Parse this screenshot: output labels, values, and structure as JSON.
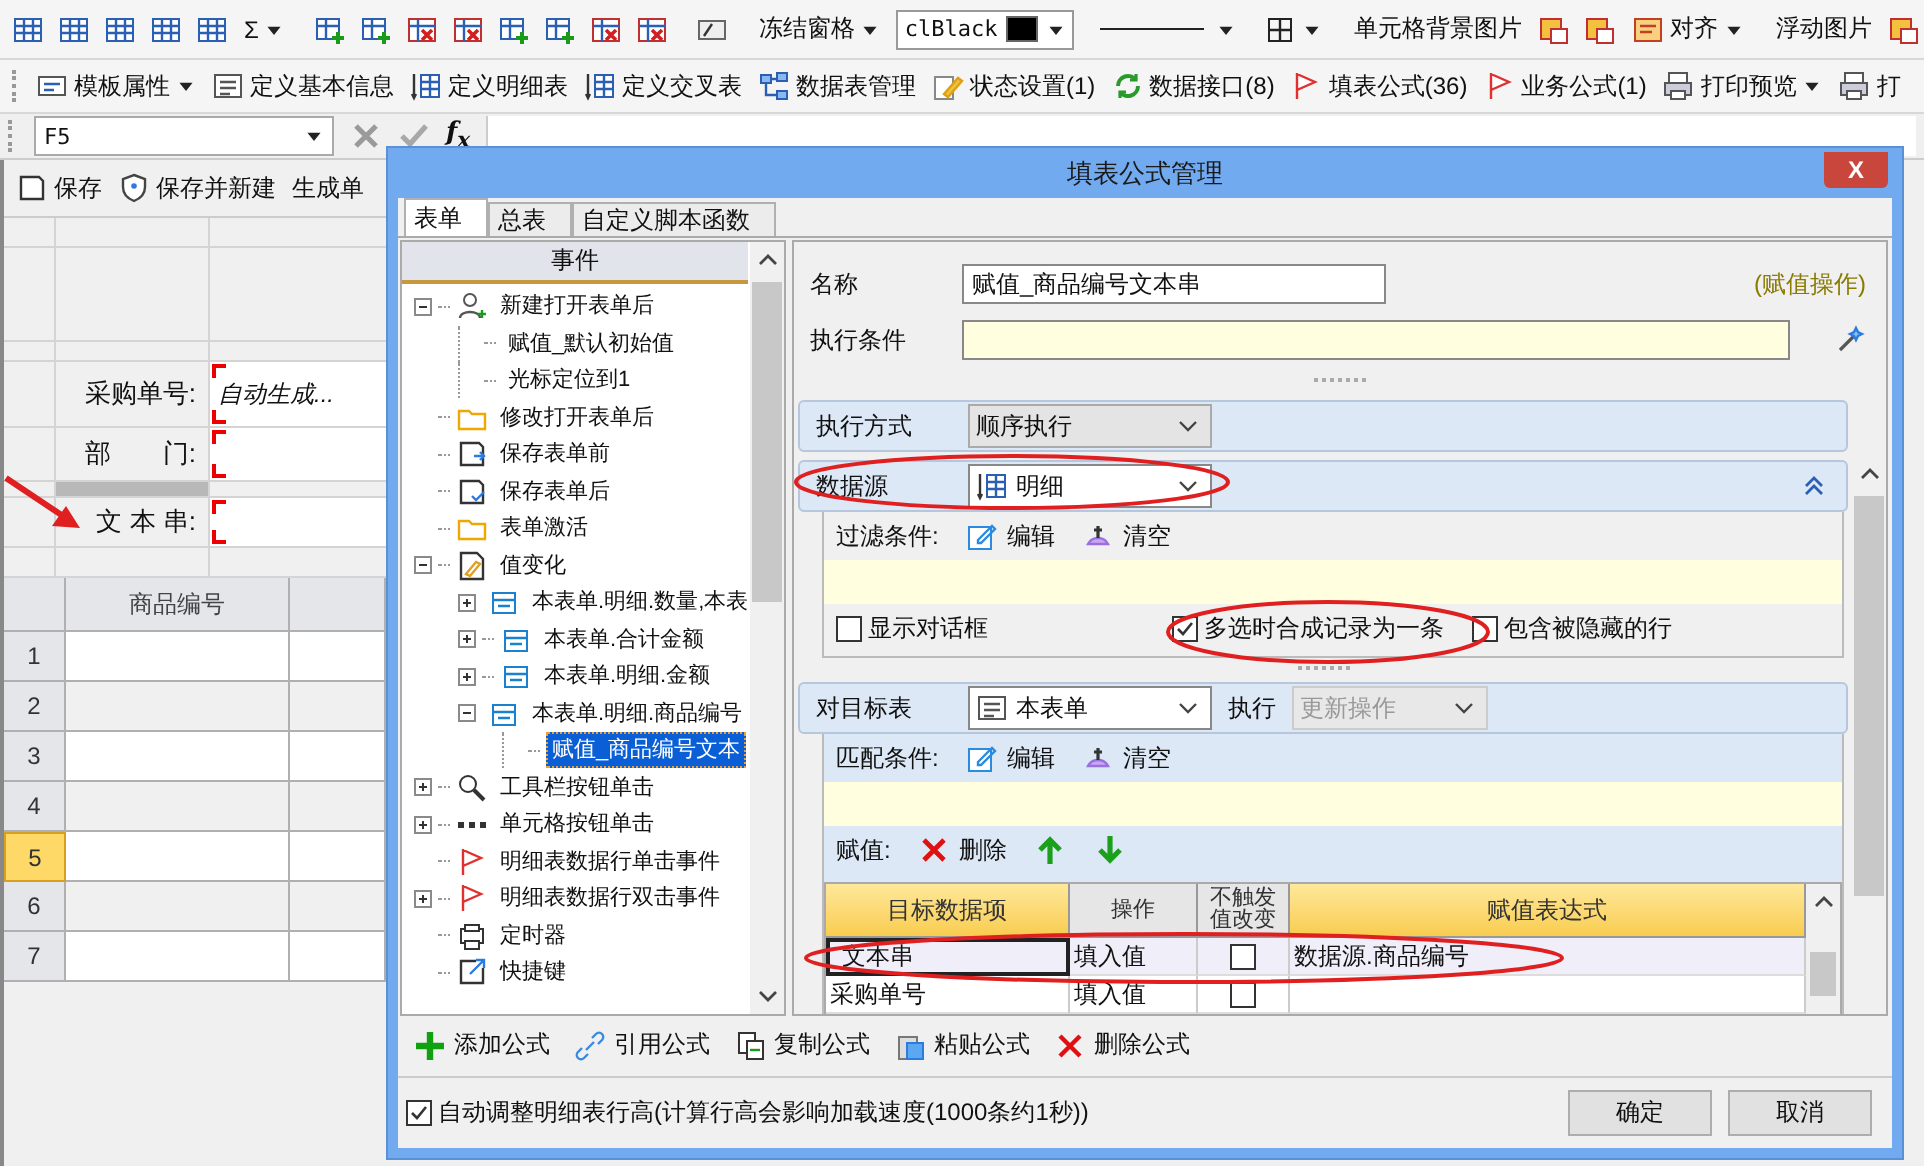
{
  "toolbar_top": {
    "sum": "Σ",
    "freeze": "冻结窗格",
    "color_value": "clBlack",
    "cell_background": "单元格背景图片",
    "align": "对齐",
    "float_image": "浮动图片"
  },
  "toolbar_main": [
    {
      "label": "模板属性",
      "kind": "template",
      "menu": true
    },
    {
      "label": "定义基本信息",
      "kind": "info"
    },
    {
      "label": "定义明细表",
      "kind": "detail"
    },
    {
      "label": "定义交叉表",
      "kind": "detail"
    },
    {
      "label": "数据表管理",
      "kind": "tables"
    },
    {
      "label": "状态设置(1)",
      "kind": "state"
    },
    {
      "label": "数据接口(8)",
      "kind": "sync"
    },
    {
      "label": "填表公式(36)",
      "kind": "flag"
    },
    {
      "label": "业务公式(1)",
      "kind": "flag"
    },
    {
      "label": "打印预览",
      "kind": "print",
      "menu": true
    },
    {
      "label": "打",
      "kind": "print"
    }
  ],
  "formula_bar": {
    "cell": "F5",
    "function_label": "f$_{x}$"
  },
  "document_toolbar": [
    {
      "label": "保存",
      "kind": "save"
    },
    {
      "label": "保存并新建",
      "kind": "shield"
    },
    {
      "label": "生成单",
      "kind": "plain"
    }
  ],
  "form_fields": [
    {
      "label": "采购单号:",
      "value": "自动生成..."
    },
    {
      "label": "部　　门:"
    },
    {
      "label": "文 本 串:"
    }
  ],
  "sheet_grid": {
    "column": "商品编号",
    "rows": [
      {
        "label": "1",
        "selected": false
      },
      {
        "label": "2",
        "selected": false
      },
      {
        "label": "3",
        "selected": false
      },
      {
        "label": "4",
        "selected": false
      },
      {
        "label": "5",
        "selected": true
      },
      {
        "label": "6",
        "selected": false
      },
      {
        "label": "7",
        "selected": false
      }
    ]
  },
  "dialog": {
    "title": "填表公式管理",
    "close": "X",
    "tabs": [
      {
        "label": "表单",
        "selected": true
      },
      {
        "label": "总表",
        "selected": false
      },
      {
        "label": "自定义脚本函数",
        "selected": false
      }
    ],
    "tree": {
      "header": "事件",
      "nodes": [
        {
          "label": "新建打开表单后",
          "kind": "user",
          "expanded": true,
          "selected": false,
          "children": [
            {
              "label": "赋值_默认初始值",
              "selected": false
            },
            {
              "label": "光标定位到1",
              "selected": false
            }
          ]
        },
        {
          "label": "修改打开表单后",
          "kind": "folder",
          "selected": false
        },
        {
          "label": "保存表单前",
          "kind": "save",
          "selected": false
        },
        {
          "label": "保存表单后",
          "kind": "saved",
          "selected": false
        },
        {
          "label": "表单激活",
          "kind": "folder",
          "selected": false
        },
        {
          "label": "值变化",
          "kind": "value",
          "expanded": true,
          "selected": false,
          "children": [
            {
              "label": "本表单.明细.数量,本表",
              "kind": "table",
              "expanded": false,
              "selected": false
            },
            {
              "label": "本表单.合计金额",
              "kind": "table",
              "expanded": false,
              "selected": false
            },
            {
              "label": "本表单.明细.金额",
              "kind": "table",
              "expanded": false,
              "selected": false
            },
            {
              "label": "本表单.明细.商品编号",
              "kind": "table",
              "expanded": true,
              "selected": false,
              "children": [
                {
                  "label": "赋值_商品编号文本",
                  "selected": true
                }
              ]
            }
          ]
        },
        {
          "label": "工具栏按钮单击",
          "kind": "search",
          "expanded": false,
          "selected": false
        },
        {
          "label": "单元格按钮单击",
          "kind": "dots",
          "expanded": false,
          "selected": false
        },
        {
          "label": "明细表数据行单击事件",
          "kind": "flag",
          "selected": false
        },
        {
          "label": "明细表数据行双击事件",
          "kind": "flag",
          "expanded": false,
          "selected": false
        },
        {
          "label": "定时器",
          "kind": "timer",
          "selected": false
        },
        {
          "label": "快捷键",
          "kind": "link",
          "selected": false
        }
      ]
    },
    "name_label": "名称",
    "name_value": "赋值_商品编号文本串",
    "operation_note": "(赋值操作)",
    "condition_label": "执行条件",
    "mode": {
      "label": "执行方式",
      "value": "顺序执行"
    },
    "source": {
      "label": "数据源",
      "value": "明细",
      "expanded": true,
      "filter_label": "过滤条件:",
      "edit": "编辑",
      "clear": "清空",
      "options": [
        {
          "label": "显示对话框",
          "checked": false
        },
        {
          "label": "多选时合成记录为一条",
          "checked": true
        },
        {
          "label": "包含被隐藏的行",
          "checked": false
        }
      ]
    },
    "target": {
      "label": "对目标表",
      "value": "本表单",
      "action_label": "执行",
      "action_value": "更新操作",
      "action_disabled": true,
      "match_label": "匹配条件:",
      "edit": "编辑",
      "clear": "清空",
      "assign_label": "赋值:",
      "delete": "删除"
    },
    "assign_table": {
      "columns": [
        {
          "label": "目标数据项",
          "highlighted": true
        },
        {
          "label": "操作",
          "highlighted": false
        },
        {
          "label": "不触发值改变",
          "highlighted": false
        },
        {
          "label": "赋值表达式",
          "highlighted": true
        }
      ],
      "rows": [
        {
          "target": "文本串",
          "operation": "填入值",
          "no_trigger": false,
          "expression": "数据源.商品编号",
          "selected": true
        },
        {
          "target": "采购单号",
          "operation": "填入值",
          "no_trigger": false,
          "selected": false
        }
      ]
    },
    "actions": [
      {
        "label": "添加公式",
        "kind": "add"
      },
      {
        "label": "引用公式",
        "kind": "chain"
      },
      {
        "label": "复制公式",
        "kind": "copy"
      },
      {
        "label": "粘贴公式",
        "kind": "paste"
      },
      {
        "label": "删除公式",
        "kind": "delete"
      }
    ],
    "auto_height": {
      "label": "自动调整明细表行高(计算行高会影响加载速度(1000条约1秒))",
      "checked": true
    },
    "buttons": [
      "确定",
      "取消"
    ]
  }
}
